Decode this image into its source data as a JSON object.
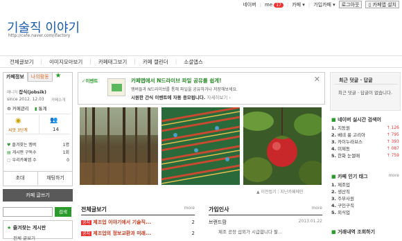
{
  "topbar": {
    "naver": "네이버",
    "me": "me",
    "me_count": "17",
    "cafe": "카페",
    "join_status": "가입카페",
    "logout": "로그아웃",
    "install": "카페앱 설치"
  },
  "cafe": {
    "title": "기술직 이야기",
    "url": "http://cafe.naver.com/ifactory"
  },
  "menu": [
    "전체글보기",
    "이미지모아보기",
    "카페태그보기",
    "카페 캘린더",
    "소셜앱스"
  ],
  "left": {
    "tab_info": "카페정보",
    "tab_activity": "나의활동",
    "manager_label": "매니저",
    "manager_name": "잡식(jobsik)",
    "since": "since 2012. 12.03",
    "cafe_intro": "카페소개",
    "admin": "카페관리",
    "stats": "통계",
    "grade": "씨앗 3단계",
    "members": "14",
    "fav_members": "즐겨찾는 멤버",
    "fav_count": "1명",
    "posting_subs": "게시판 구독수",
    "posting_count": "1회",
    "cafe_tel": "우리카페앱 수",
    "tel_count": "0",
    "invite": "초대",
    "chat": "채팅하기",
    "write": "카페 글쓰기",
    "search_btn": "검색",
    "fav_board": "즐겨찾는 게시판",
    "fav_board_item": "전체 글보기"
  },
  "event": {
    "badge": "✓이벤트",
    "title": "카페앱에서 N드라이브 파일 공유를 쉽게!",
    "desc1": "멤버들과 N드라이브를 통해 파일을 공유하거나 저장해보세요.",
    "desc2": "시원한 간식 이벤트에 자동 응모됩니다.",
    "more": "자세히보기 ›"
  },
  "photo_caption": {
    "prev": "▲ 이전접기",
    "next": "지난카페메인"
  },
  "board_all": {
    "title": "전체글보기",
    "more": "more",
    "rows": [
      {
        "tag": "공지",
        "text": "제조업 이야기에서 기술직...",
        "count": "2"
      },
      {
        "tag": "공지",
        "text": "제조업의 정보교환과 미래...",
        "count": "2"
      }
    ]
  },
  "board_join": {
    "title": "가입인사",
    "more": "more",
    "rows": [
      {
        "title": "브랜드팜",
        "date": "2013.01.22",
        "desc": "제조 공장 섭외가 시급합니다 팔..."
      }
    ]
  },
  "right": {
    "recent_title": "최근 덧글 · 답글",
    "recent_empty": "최근 덧글 · 답글이 없습니다.",
    "search_rank_title": "네이버 실시간 검색어",
    "search_rank": [
      {
        "rank": "1.",
        "term": "지동원",
        "diff": "↑ 126"
      },
      {
        "rank": "2.",
        "term": "베네 룽 고리아",
        "diff": "↑ 795"
      },
      {
        "rank": "3.",
        "term": "카이누라브스",
        "diff": "↑ 393"
      },
      {
        "rank": "4.",
        "term": "미제동",
        "diff": "↑ 087"
      },
      {
        "rank": "5.",
        "term": "한화 눈썰매",
        "diff": "↑ 759"
      }
    ],
    "popular_tag_title": "카페 인기 태그",
    "popular_more": "more",
    "tags": [
      {
        "rank": "1.",
        "term": "제조업"
      },
      {
        "rank": "2.",
        "term": "생산직"
      },
      {
        "rank": "3.",
        "term": "주부사원"
      },
      {
        "rank": "4.",
        "term": "구인구직"
      },
      {
        "rank": "5.",
        "term": "외식업"
      }
    ],
    "history_title": "거래내역 조회하기"
  }
}
